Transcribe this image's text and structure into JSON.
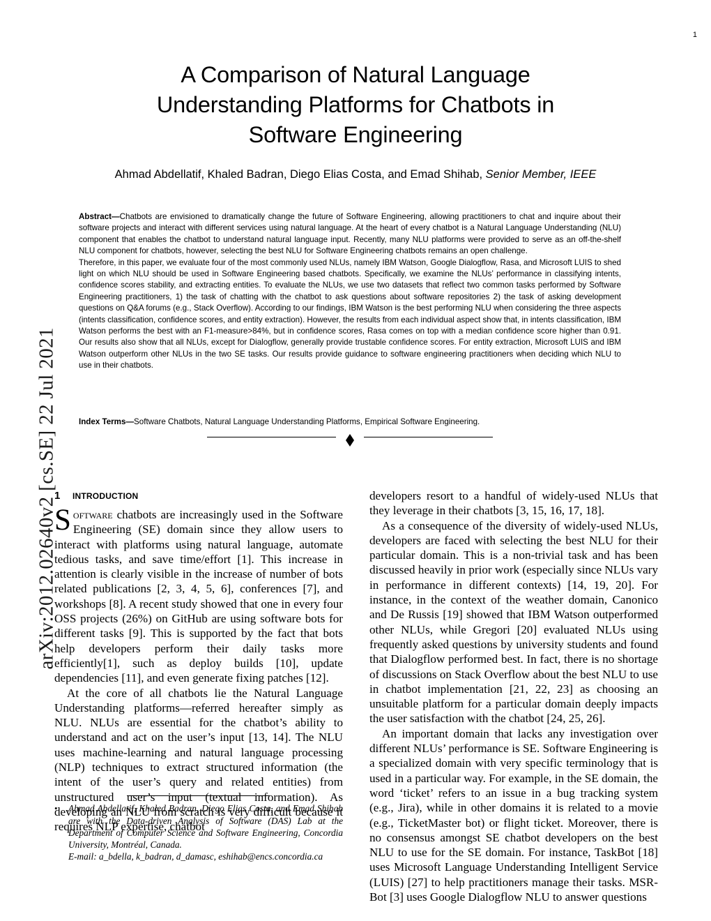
{
  "page": {
    "number": "1",
    "arxiv_stamp": "arXiv:2012.02640v2  [cs.SE]  22 Jul 2021"
  },
  "header": {
    "title": "A Comparison of Natural Language Understanding Platforms for Chatbots in Software Engineering",
    "authors_plain": "Ahmad Abdellatif, Khaled Badran, Diego Elias Costa, and Emad Shihab, ",
    "authors_italic": "Senior Member, IEEE"
  },
  "abstract": {
    "label": "Abstract—",
    "paragraph1": "Chatbots are envisioned to dramatically change the future of Software Engineering, allowing practitioners to chat and inquire about their software projects and interact with different services using natural language. At the heart of every chatbot is a Natural Language Understanding (NLU) component that enables the chatbot to understand natural language input. Recently, many NLU platforms were provided to serve as an off-the-shelf NLU component for chatbots, however, selecting the best NLU for Software Engineering chatbots remains an open challenge.",
    "paragraph2": "Therefore, in this paper, we evaluate four of the most commonly used NLUs, namely IBM Watson, Google Dialogflow, Rasa, and Microsoft LUIS to shed light on which NLU should be used in Software Engineering based chatbots. Specifically, we examine the NLUs’ performance in classifying intents, confidence scores stability, and extracting entities. To evaluate the NLUs, we use two datasets that reflect two common tasks performed by Software Engineering practitioners, 1) the task of chatting with the chatbot to ask questions about software repositories 2) the task of asking development questions on Q&A forums (e.g., Stack Overflow). According to our findings, IBM Watson is the best performing NLU when considering the three aspects (intents classification, confidence scores, and entity extraction). However, the results from each individual aspect show that, in intents classification, IBM Watson performs the best with an F1-measure>84%, but in confidence scores, Rasa comes on top with a median confidence score higher than 0.91. Our results also show that all NLUs, except for Dialogflow, generally provide trustable confidence scores. For entity extraction, Microsoft LUIS and IBM Watson outperform other NLUs in the two SE tasks. Our results provide guidance to software engineering practitioners when deciding which NLU to use in their chatbots."
  },
  "index_terms": {
    "label": "Index Terms—",
    "text": "Software Chatbots, Natural Language Understanding Platforms, Empirical Software Engineering."
  },
  "section": {
    "number": "1",
    "title": "Introduction"
  },
  "left_column": {
    "dropcap": "S",
    "smallcaps": "oftware",
    "p1_rest": " chatbots are increasingly used in the Software Engineering (SE) domain since they allow users to interact with platforms using natural language, automate tedious tasks, and save time/effort [1]. This increase in attention is clearly visible in the increase of number of bots related publications [2, 3, 4, 5, 6], conferences [7], and workshops [8]. A recent study showed that one in every four OSS projects (26%) on GitHub are using software bots for different tasks [9]. This is supported by the fact that bots help developers perform their daily tasks more efficiently[1], such as deploy builds [10], update dependencies [11], and even generate fixing patches [12].",
    "p2": "At the core of all chatbots lie the Natural Language Understanding platforms—referred hereafter simply as NLU. NLUs are essential for the chatbot’s ability to understand and act on the user’s input [13, 14]. The NLU uses machine-learning and natural language processing (NLP) techniques to extract structured information (the intent of the user’s query and related entities) from unstructured user’s input (textual information). As developing an NLU from scratch is very difficult because it requires NLP expertise, chatbot"
  },
  "right_column": {
    "p1": "developers resort to a handful of widely-used NLUs that they leverage in their chatbots [3, 15, 16, 17, 18].",
    "p2": "As a consequence of the diversity of widely-used NLUs, developers are faced with selecting the best NLU for their particular domain. This is a non-trivial task and has been discussed heavily in prior work (especially since NLUs vary in performance in different contexts) [14, 19, 20]. For instance, in the context of the weather domain, Canonico and De Russis [19] showed that IBM Watson outperformed other NLUs, while Gregori [20] evaluated NLUs using frequently asked questions by university students and found that Dialogflow performed best. In fact, there is no shortage of discussions on Stack Overflow about the best NLU to use in chatbot implementation [21, 22, 23] as choosing an unsuitable platform for a particular domain deeply impacts the user satisfaction with the chatbot [24, 25, 26].",
    "p3": "An important domain that lacks any investigation over different NLUs’ performance is SE. Software Engineering is a specialized domain with very specific terminology that is used in a particular way. For example, in the SE domain, the word ‘ticket’ refers to an issue in a bug tracking system (e.g., Jira), while in other domains it is related to a movie (e.g., TicketMaster bot) or flight ticket. Moreover, there is no consensus amongst SE chatbot developers on the best NLU to use for the SE domain. For instance, TaskBot [18] uses Microsoft Language Understanding Intelligent Service (LUIS) [27] to help practitioners manage their tasks. MSR-Bot [3] uses Google Dialogflow NLU to answer questions"
  },
  "footnote": {
    "bullet": "•",
    "affiliation": "Ahmad Abdellatif, Khaled Badran, Diego Elias Costa, and Emad Shihab are with the Data-driven Analysis of Software (DAS) Lab at the Department of Computer Science and Software Engineering, Concordia University, Montréal, Canada.",
    "email": "E-mail: a_bdella, k_badran, d_damasc, eshihab@encs.concordia.ca"
  }
}
